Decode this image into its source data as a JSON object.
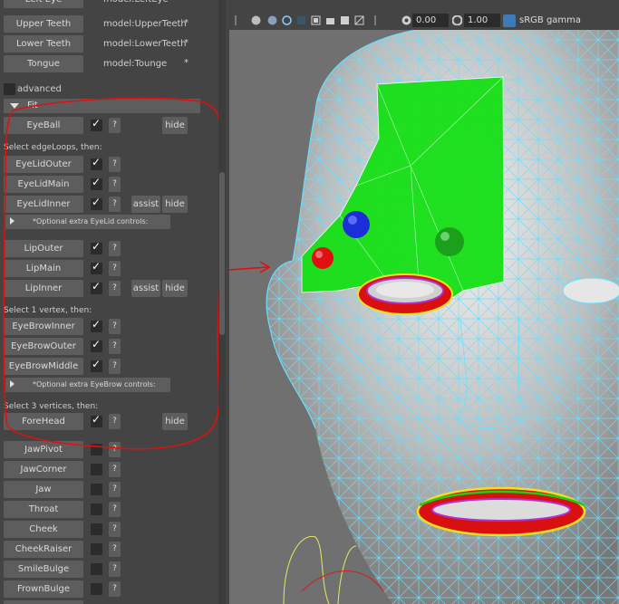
{
  "panel": {
    "top_buttons": [
      {
        "label": "Left Eye",
        "model": "model:LeftEye",
        "star": "*"
      },
      {
        "label": "Upper Teeth",
        "model": "model:UpperTeeth",
        "star": "*"
      },
      {
        "label": "Lower Teeth",
        "model": "model:LowerTeeth",
        "star": "*"
      },
      {
        "label": "Tongue",
        "model": "model:Tounge",
        "star": "*"
      }
    ],
    "advanced_label": "advanced",
    "fit_label": "Fit",
    "q": "?",
    "assist": "assist",
    "hide": "hide",
    "edge_loops_label": "Select edgeLoops, then:",
    "one_vertex_label": "Select 1 vertex, then:",
    "three_vertices_label": "Select 3 vertices, then:",
    "eyelid_opt": "*Optional extra EyeLid controls:",
    "eyebrow_opt": "*Optional extra EyeBrow controls:",
    "items": {
      "eyeball": "EyeBall",
      "eyelid_outer": "EyeLidOuter",
      "eyelid_main": "EyeLidMain",
      "eyelid_inner": "EyeLidInner",
      "lip_outer": "LipOuter",
      "lip_main": "LipMain",
      "lip_inner": "LipInner",
      "eyebrow_inner": "EyeBrowInner",
      "eyebrow_outer": "EyeBrowOuter",
      "eyebrow_middle": "EyeBrowMiddle",
      "forehead": "ForeHead",
      "jaw_pivot": "JawPivot",
      "jaw_corner": "JawCorner",
      "jaw": "Jaw",
      "throat": "Throat",
      "cheek": "Cheek",
      "cheek_raiser": "CheekRaiser",
      "smile_bulge": "SmileBulge",
      "frown_bulge": "FrownBulge"
    }
  },
  "toolbar": {
    "value1": "0.00",
    "value2": "1.00",
    "colorspace": "sRGB gamma"
  },
  "colors": {
    "wireframe": "#66e0ff",
    "fit_mesh": "#00ff00",
    "annotation": "#ff0000"
  }
}
